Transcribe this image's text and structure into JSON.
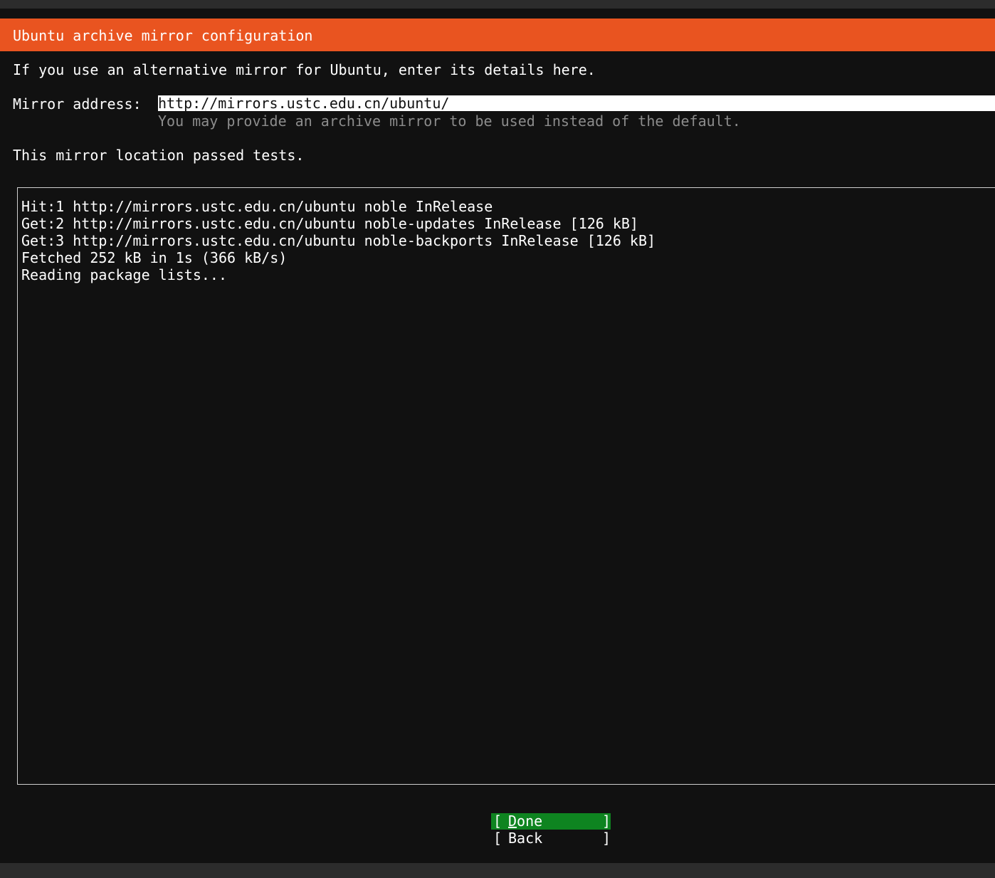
{
  "title": "Ubuntu archive mirror configuration",
  "intro": "If you use an alternative mirror for Ubuntu, enter its details here.",
  "mirror": {
    "label": "Mirror address:",
    "value": "http://mirrors.ustc.edu.cn/ubuntu/",
    "help": "You may provide an archive mirror to be used instead of the default."
  },
  "status": "This mirror location passed tests.",
  "log": [
    "Hit:1 http://mirrors.ustc.edu.cn/ubuntu noble InRelease",
    "Get:2 http://mirrors.ustc.edu.cn/ubuntu noble-updates InRelease [126 kB]",
    "Get:3 http://mirrors.ustc.edu.cn/ubuntu noble-backports InRelease [126 kB]",
    "Fetched 252 kB in 1s (366 kB/s)",
    "Reading package lists..."
  ],
  "buttons": {
    "done": "Done",
    "back": "Back",
    "open_bracket": "[",
    "close_bracket": "]"
  },
  "colors": {
    "title_bar": "#e95420",
    "done_button": "#0e8420",
    "background": "#111111"
  }
}
